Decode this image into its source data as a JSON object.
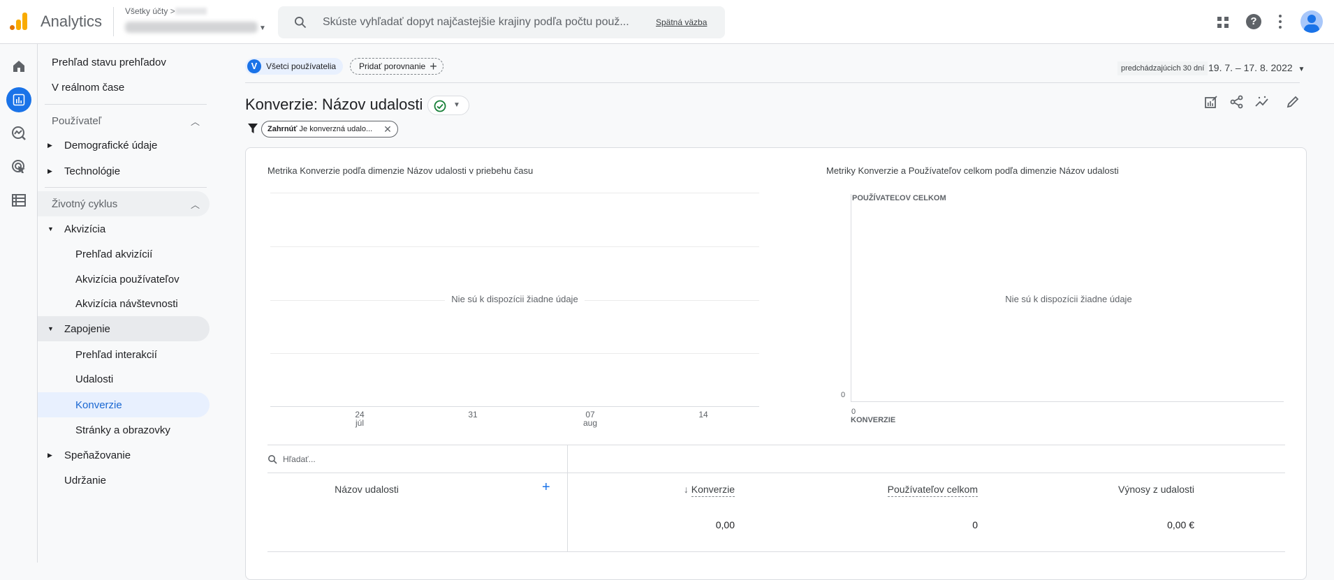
{
  "header": {
    "app_name": "Analytics",
    "account_breadcrumb": "Všetky účty >",
    "search_placeholder": "Skúste vyhľadať dopyt najčastejšie krajiny podľa počtu použ...",
    "feedback_link": "Spätná väzba",
    "icons": [
      "apps-grid-icon",
      "help-icon",
      "more-vert-icon",
      "avatar"
    ]
  },
  "rail": {
    "icons": [
      "home-icon",
      "reports-icon",
      "explore-icon",
      "advertising-icon",
      "configure-icon"
    ],
    "active": "reports-icon",
    "accent": "#1a73e8"
  },
  "sidebar": {
    "items": [
      {
        "label": "Prehľad stavu prehľadov"
      },
      {
        "label": "V reálnom čase"
      },
      {
        "label": "Používateľ"
      },
      {
        "label": "Demografické údaje"
      },
      {
        "label": "Technológie"
      },
      {
        "label": "Životný cyklus"
      },
      {
        "label": "Akvizícia"
      },
      {
        "label": "Prehľad akvizícií"
      },
      {
        "label": "Akvizícia používateľov"
      },
      {
        "label": "Akvizícia návštevnosti"
      },
      {
        "label": "Zapojenie"
      },
      {
        "label": "Prehľad interakcií"
      },
      {
        "label": "Udalosti"
      },
      {
        "label": "Konverzie"
      },
      {
        "label": "Stránky a obrazovky"
      },
      {
        "label": "Speňažovanie"
      },
      {
        "label": "Udržanie"
      }
    ],
    "active_label": "Konverzie"
  },
  "comparison": {
    "segment_initial": "V",
    "segment_label": "Všetci používatelia",
    "add_comparison": "Pridať porovnanie"
  },
  "date_range": {
    "preset": "predchádzajúcich 30 dní",
    "value": "19. 7. – 17. 8. 2022"
  },
  "report": {
    "title": "Konverzie: Názov udalosti",
    "filter_label": "Zahrnúť",
    "filter_value": "Je konverzná udalo...",
    "toolbar_icons": [
      "customize-report-icon",
      "share-icon",
      "insights-icon",
      "edit-icon"
    ]
  },
  "chart_data": [
    {
      "type": "line",
      "title": "Metrika Konverzie podľa dimenzie Názov udalosti v priebehu času",
      "empty_message": "Nie sú k dispozícii žiadne údaje",
      "x_ticks": [
        {
          "day": "24",
          "month": "júl"
        },
        {
          "day": "31",
          "month": ""
        },
        {
          "day": "07",
          "month": "aug"
        },
        {
          "day": "14",
          "month": ""
        }
      ],
      "series": [],
      "grid": true
    },
    {
      "type": "scatter",
      "title": "Metriky Konverzie a Používateľov celkom podľa dimenzie Názov udalosti",
      "empty_message": "Nie sú k dispozícii žiadne údaje",
      "ylabel": "POUŽÍVATEĽOV CELKOM",
      "xlabel": "KONVERZIE",
      "y_tick": "0",
      "x_tick": "0",
      "series": []
    }
  ],
  "table": {
    "search_placeholder": "Hľadať...",
    "dimension_header": "Názov udalosti",
    "columns": [
      "Konverzie",
      "Používateľov celkom",
      "Výnosy z udalosti"
    ],
    "sort_column": "Konverzie",
    "totals": [
      "0,00",
      "0",
      "0,00 €"
    ]
  }
}
